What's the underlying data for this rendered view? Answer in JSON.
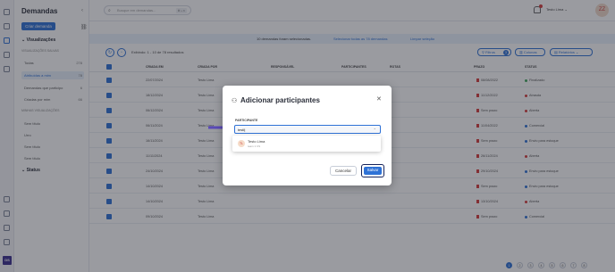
{
  "sidebar": {
    "title": "Demandas",
    "collapse_icon": "chevron-left-icon",
    "new_button": "Criar demanda",
    "views_header": "Visualizações",
    "group_saved": "VISUALIZAÇÕES SALVAS",
    "views": [
      {
        "label": "Todas",
        "count": "278"
      },
      {
        "label": "Atribuídas a mim",
        "count": "78"
      },
      {
        "label": "Demandas que participo",
        "count": "6"
      },
      {
        "label": "Criadas por mim",
        "count": "66"
      }
    ],
    "group_mine": "MINHAS VISUALIZAÇÕES",
    "mine": [
      {
        "label": "Sem título"
      },
      {
        "label": "Urro"
      },
      {
        "label": "Sem título"
      },
      {
        "label": "Sem título"
      }
    ],
    "status_header": "Status"
  },
  "topbar": {
    "search_placeholder": "Busque em demandas...",
    "search_shortcut": "⌘ + K",
    "user_name": "Testo Lima",
    "avatar_initials": "ZZ"
  },
  "selection_bar": {
    "message": "10 demandas foram selecionadas.",
    "select_all": "Selecionar todas as 78 demandas",
    "clear": "Limpar seleção"
  },
  "toolbar": {
    "showing": "Exibindo: 1 - 10 de 78 resultados",
    "filters_label": "Filtros",
    "filters_count": "3",
    "columns_label": "Colunas",
    "reports_label": "Relatórios"
  },
  "table": {
    "headers": [
      "CRIADA EM",
      "CRIADA POR",
      "RESPONSÁVEL",
      "PARTICIPANTES",
      "ROTAS",
      "PRAZO",
      "STATUS"
    ],
    "rows": [
      {
        "date": "22/07/2024",
        "creator": "Testo Lima",
        "resp": "",
        "part": "",
        "due": "08/08/2022",
        "status": "Finalizado",
        "scolor": "#3fa55b"
      },
      {
        "date": "18/12/2024",
        "creator": "Testo Lima",
        "resp": "",
        "part": "",
        "due": "11/12/2022",
        "status": "Atrasda",
        "scolor": "#d63b3b"
      },
      {
        "date": "06/12/2024",
        "creator": "Testo Lima",
        "resp": "",
        "part": "",
        "due": "Sem prazo",
        "status": "Aberta",
        "scolor": "#d63b3b"
      },
      {
        "date": "06/11/2024",
        "creator": "Testo Lima",
        "resp": "",
        "part": "",
        "due": "11/04/2022",
        "status": "Comercial",
        "scolor": "#2f72d6"
      },
      {
        "date": "16/11/2024",
        "creator": "Testo Lima",
        "resp": "",
        "part": "",
        "due": "Sem prazo",
        "status": "Envio para estoque",
        "scolor": "#2f72d6"
      },
      {
        "date": "11/11/2024",
        "creator": "Testo Lima",
        "resp": "",
        "part": "",
        "due": "26/11/2024",
        "status": "Aberta",
        "scolor": "#d63b3b"
      },
      {
        "date": "24/10/2024",
        "creator": "Testo Lima",
        "resp": "",
        "part": "",
        "due": "29/10/2024",
        "status": "Envio para estoque",
        "scolor": "#2f72d6"
      },
      {
        "date": "14/10/2024",
        "creator": "Testo Lima",
        "resp": "",
        "part": "",
        "due": "Sem prazo",
        "status": "Envio para estoque",
        "scolor": "#2f72d6"
      },
      {
        "date": "14/10/2024",
        "creator": "Testo Lima",
        "resp": "",
        "part": "",
        "due": "13/10/2024",
        "status": "Aberta",
        "scolor": "#d63b3b"
      },
      {
        "date": "09/10/2024",
        "creator": "Testo Lima",
        "resp": "",
        "part": "",
        "due": "Sem prazo",
        "status": "Comercial",
        "scolor": "#2f72d6"
      }
    ]
  },
  "pagination": {
    "pages": [
      "1",
      "2",
      "3",
      "4",
      "5",
      "6",
      "7",
      "8"
    ],
    "current": "1"
  },
  "modal": {
    "title": "Adicionar participantes",
    "field_label": "PARTICIPANTE",
    "input_value": "testl",
    "option_name": "Testo Lima",
    "option_team": "team 1 CS",
    "option_initials": "TL",
    "cancel_label": "Cancelar",
    "save_label": "Salvar"
  },
  "colors": {
    "accent": "#2f72d6",
    "arrow": "#5a4ab8"
  }
}
